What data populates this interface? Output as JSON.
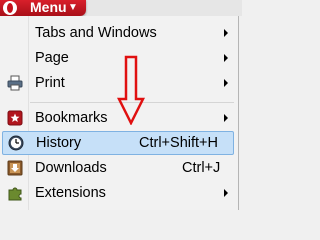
{
  "menu_button": {
    "label": "Menu",
    "chevron": "chevron-down-icon"
  },
  "items": [
    {
      "label": "Tabs and Windows",
      "shortcut": "",
      "submenu": true,
      "icon": ""
    },
    {
      "label": "Page",
      "shortcut": "",
      "submenu": true,
      "icon": ""
    },
    {
      "label": "Print",
      "shortcut": "",
      "submenu": true,
      "icon": "printer-icon"
    },
    {
      "label": "Bookmarks",
      "shortcut": "",
      "submenu": true,
      "icon": "bookmark-icon"
    },
    {
      "label": "History",
      "shortcut": "Ctrl+Shift+H",
      "submenu": false,
      "icon": "clock-icon",
      "highlighted": true
    },
    {
      "label": "Downloads",
      "shortcut": "Ctrl+J",
      "submenu": false,
      "icon": "download-icon"
    },
    {
      "label": "Extensions",
      "shortcut": "",
      "submenu": true,
      "icon": "puzzle-icon"
    }
  ],
  "colors": {
    "menu_button": "#c4121c",
    "highlight_bg": "#c6e0f8",
    "highlight_border": "#7fb2e2",
    "annotation_arrow": "#e01010"
  },
  "annotation": {
    "icon": "down-arrow-annotation-icon"
  }
}
